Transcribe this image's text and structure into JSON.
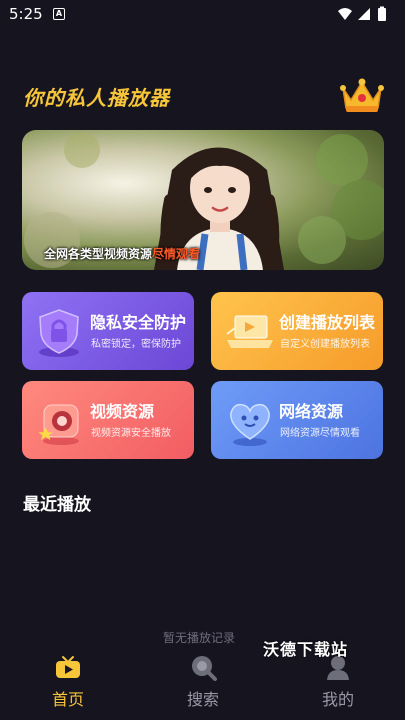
{
  "status": {
    "time": "5:25",
    "notification_badge": "A"
  },
  "header": {
    "title": "你的私人播放器",
    "crown_icon": "crown-icon"
  },
  "banner": {
    "caption_main": "全网各类型视频资源",
    "caption_highlight": "尽情观看"
  },
  "cards": [
    {
      "title": "隐私安全防护",
      "subtitle": "私密锁定，密保防护",
      "icon": "shield-lock-icon"
    },
    {
      "title": "创建播放列表",
      "subtitle": "自定义创建播放列表",
      "icon": "playlist-laptop-icon"
    },
    {
      "title": "视频资源",
      "subtitle": "视频资源安全播放",
      "icon": "camera-icon"
    },
    {
      "title": "网络资源",
      "subtitle": "网络资源尽情观看",
      "icon": "heart-network-icon"
    }
  ],
  "recent": {
    "title": "最近播放",
    "empty_text": "暂无播放记录"
  },
  "nav": [
    {
      "label": "首页",
      "icon": "tv-icon",
      "active": true
    },
    {
      "label": "搜索",
      "icon": "search-icon",
      "active": false
    },
    {
      "label": "我的",
      "icon": "profile-icon",
      "active": false
    }
  ],
  "watermark": "沃德下载站",
  "colors": {
    "accent": "#f7c53a",
    "background": "#15141f",
    "highlight": "#ff5a2a"
  }
}
